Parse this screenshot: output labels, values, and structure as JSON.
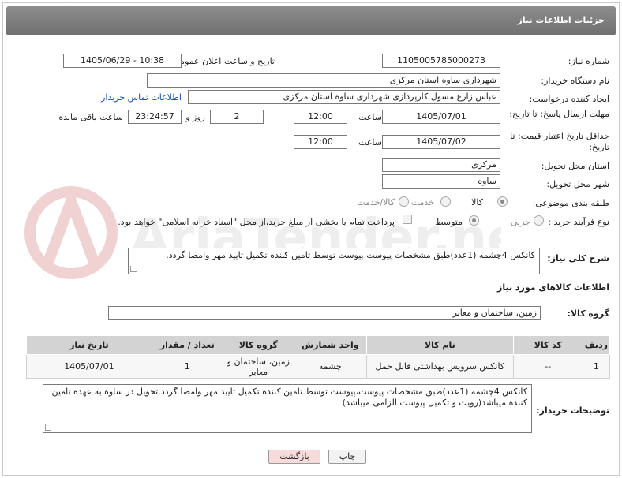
{
  "header": {
    "title": "جزئیات اطلاعات نیاز"
  },
  "fields": {
    "need_number_label": "شماره نیاز:",
    "need_number": "1105005785000273",
    "announce_label": "تاریخ و ساعت اعلان عمومی:",
    "announce_value": "1405/06/29 - 10:38",
    "buyer_org_label": "نام دستگاه خریدار:",
    "buyer_org": "شهرداری ساوه استان مرکزی",
    "requester_label": "ایجاد کننده درخواست:",
    "requester": "عباس زارع مسول کارپردازی شهرداری ساوه استان مرکزی",
    "contact_link": "اطلاعات تماس خریدار",
    "deadline_label": "مهلت ارسال پاسخ: تا تاریخ:",
    "deadline_date": "1405/07/01",
    "time_label": "ساعت",
    "deadline_time": "12:00",
    "days_value": "2",
    "days_label": "روز و",
    "remaining_time": "23:24:57",
    "remaining_label": "ساعت باقی مانده",
    "validity_label": "حداقل تاریخ اعتبار قیمت: تا تاریخ:",
    "validity_date": "1405/07/02",
    "validity_time_label": "ساعت",
    "validity_time": "12:00",
    "province_label": "استان محل تحویل:",
    "province": "مرکزی",
    "city_label": "شهر محل تحویل:",
    "city": "ساوه",
    "category_label": "طبقه بندی موضوعی:",
    "category_options": [
      "کالا",
      "خدمت",
      "کالا/خدمت"
    ],
    "process_label": "نوع فرآیند خرید :",
    "process_options": [
      "جزیی",
      "متوسط"
    ],
    "payment_text": "پرداخت تمام یا بخشی از مبلغ خرید،از محل \"اسناد خزانه اسلامی\" خواهد بود."
  },
  "description": {
    "label": "شرح کلی نیاز:",
    "text": "کانکس 4چشمه (1عدد)طبق مشخصات پیوست،پیوست توسط تامین کننده تکمیل تایید مهر وامضا گردد."
  },
  "goods": {
    "section_title": "اطلاعات کالاهای مورد نیاز",
    "group_label": "گروه کالا:",
    "group_value": "زمین، ساختمان و معابر"
  },
  "table": {
    "headers": [
      "ردیف",
      "کد کالا",
      "نام کالا",
      "واحد شمارش",
      "گروه کالا",
      "تعداد / مقدار",
      "تاریخ نیاز"
    ],
    "rows": [
      [
        "1",
        "--",
        "کانکس سرویس بهداشتی قابل حمل",
        "چشمه",
        "زمین، ساختمان و معابر",
        "1",
        "1405/07/01"
      ]
    ]
  },
  "buyer_notes": {
    "label": "توضیحات خریدار:",
    "text": "کانکس 4چشمه (1عدد)طبق مشخصات پیوست،پیوست توسط تامین کننده تکمیل تایید مهر وامضا گردد.تحویل در ساوه به عهده تامین کننده میباشد(رویت و تکمیل پیوست الزامی میباشد)"
  },
  "buttons": {
    "print": "چاپ",
    "back": "بازگشت"
  },
  "watermark": {
    "text": "AriaTender.net"
  },
  "colors": {
    "header_bg": "#7d7d7d",
    "link": "#1a4fb0",
    "back_btn_bg": "#f7dada",
    "table_header": "#d3d3d3"
  }
}
